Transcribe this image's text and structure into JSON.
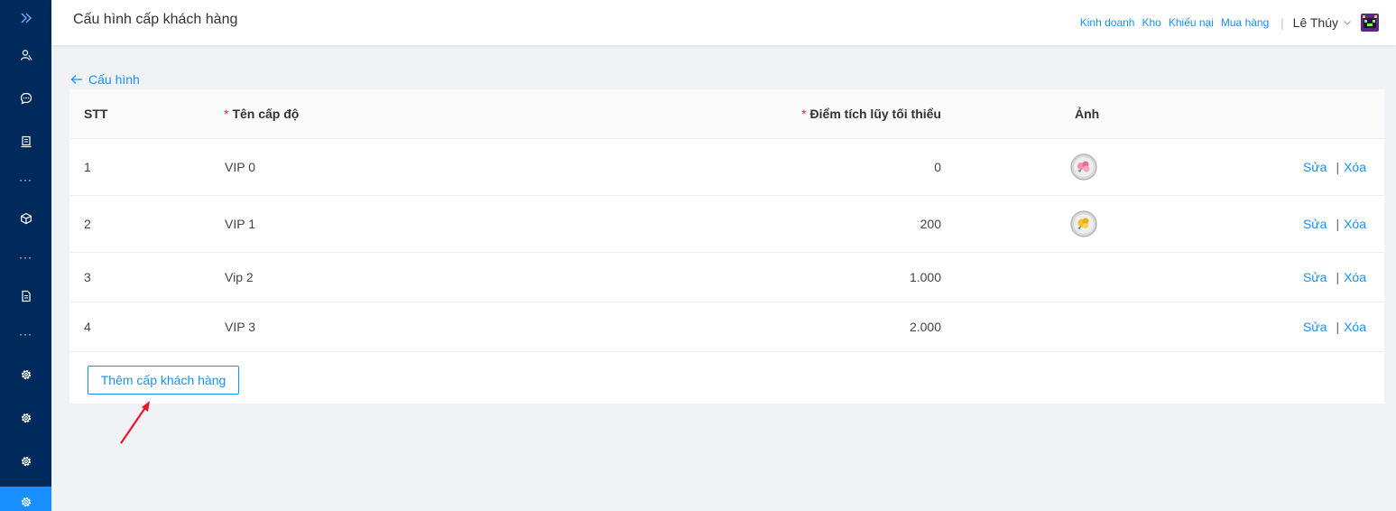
{
  "sidebar": {
    "items": [
      {
        "icon": "double-chevron-right-icon",
        "kind": "icon"
      },
      {
        "icon": "users-icon",
        "kind": "icon"
      },
      {
        "icon": "chat-icon",
        "kind": "icon"
      },
      {
        "icon": "document-stand-icon",
        "kind": "icon"
      },
      {
        "icon": "more-icon",
        "kind": "dots",
        "text": "···"
      },
      {
        "icon": "cube-icon",
        "kind": "icon"
      },
      {
        "icon": "more-icon",
        "kind": "dots",
        "text": "···"
      },
      {
        "icon": "file-icon",
        "kind": "icon"
      },
      {
        "icon": "more-icon",
        "kind": "dots",
        "text": "···"
      },
      {
        "icon": "gear-icon",
        "kind": "icon"
      },
      {
        "icon": "gear-icon",
        "kind": "icon"
      },
      {
        "icon": "gear-icon",
        "kind": "icon"
      },
      {
        "icon": "gear-icon",
        "kind": "icon",
        "active": true
      }
    ],
    "background_color": "#002a5c",
    "active_color": "#1890ff"
  },
  "header": {
    "title": "Cấu hình cấp khách hàng",
    "links": [
      "Kinh doanh",
      "Kho",
      "Khiếu nại",
      "Mua hàng"
    ],
    "separator": "|",
    "user_name": "Lê Thúy"
  },
  "breadcrumb": {
    "back_label": "Cấu hình"
  },
  "table": {
    "columns": {
      "stt": "STT",
      "name": "Tên cấp độ",
      "points": "Điểm tích lũy tối thiểu",
      "image": "Ảnh",
      "required_mark": "*"
    },
    "rows": [
      {
        "stt": "1",
        "name": "VIP 0",
        "points": "0",
        "image": "pink-flower-badge"
      },
      {
        "stt": "2",
        "name": "VIP 1",
        "points": "200",
        "image": "yellow-flower-badge"
      },
      {
        "stt": "3",
        "name": "Vip 2",
        "points": "1.000",
        "image": null
      },
      {
        "stt": "4",
        "name": "VIP 3",
        "points": "2.000",
        "image": null
      }
    ],
    "edit_label": "Sửa",
    "delete_label": "Xóa",
    "action_separator": "|"
  },
  "add_button": {
    "label": "Thêm cấp khách hàng"
  },
  "colors": {
    "accent": "#1890ff",
    "required": "#f5222d",
    "annotation_arrow": "#e8182a"
  }
}
